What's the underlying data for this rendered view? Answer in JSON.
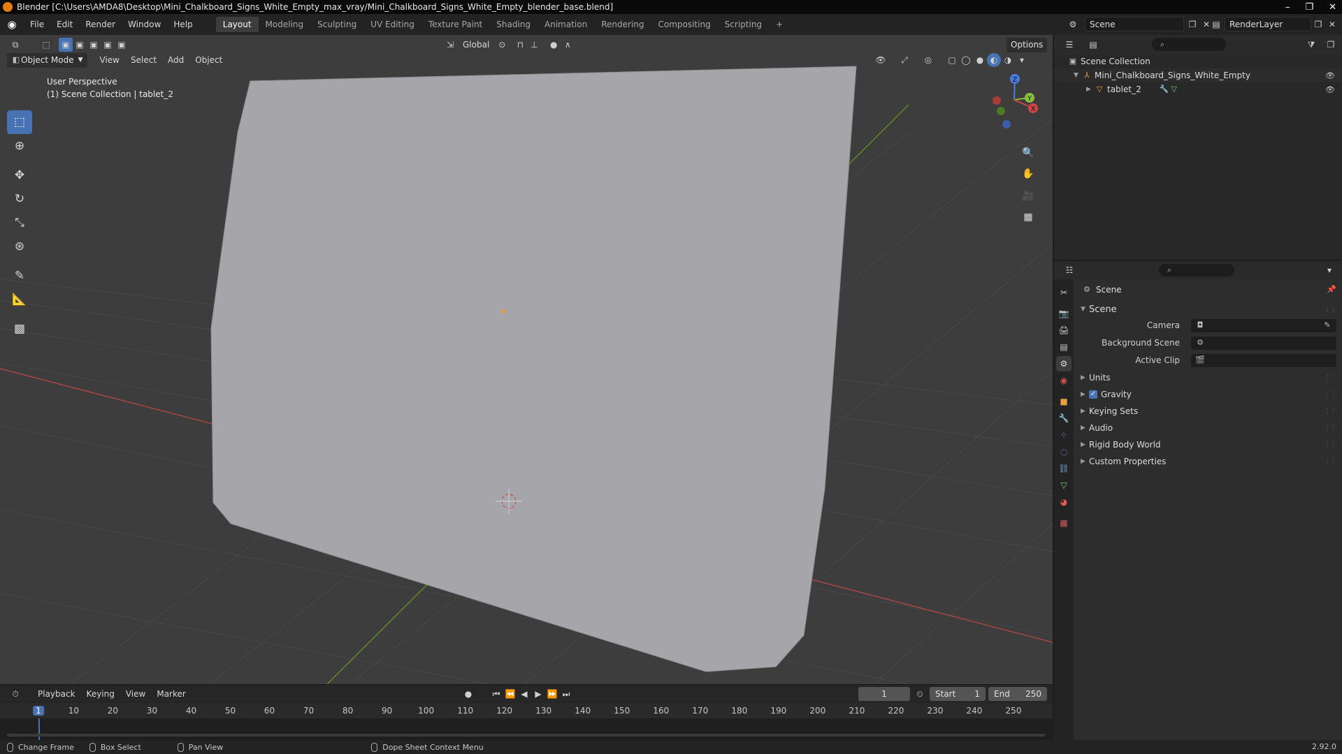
{
  "window": {
    "title": "Blender [C:\\Users\\AMDA8\\Desktop\\Mini_Chalkboard_Signs_White_Empty_max_vray/Mini_Chalkboard_Signs_White_Empty_blender_base.blend]",
    "minimize": "–",
    "maximize": "❐",
    "close": "✕"
  },
  "menu": {
    "items": [
      "File",
      "Edit",
      "Render",
      "Window",
      "Help"
    ],
    "workspaces": [
      "Layout",
      "Modeling",
      "Sculpting",
      "UV Editing",
      "Texture Paint",
      "Shading",
      "Animation",
      "Rendering",
      "Compositing",
      "Scripting"
    ],
    "active_workspace": "Layout",
    "add_workspace": "+",
    "scene": "Scene",
    "view_layer": "RenderLayer"
  },
  "viewport": {
    "mode": "Object Mode",
    "menus": [
      "View",
      "Select",
      "Add",
      "Object"
    ],
    "transform_orientation": "Global",
    "options": "Options",
    "perspective_label": "User Perspective",
    "collection_label": "(1) Scene Collection | tablet_2",
    "colors": {
      "background": "#3d3d3d",
      "board": "#a6a5aa",
      "axis_x": "#b44a4a",
      "axis_y": "#6b9a2a",
      "selected_active": "#4772b3"
    }
  },
  "gizmo": {
    "z": "Z",
    "y": "Y",
    "x": "X"
  },
  "timeline": {
    "menus": [
      "Playback",
      "Keying",
      "View",
      "Marker"
    ],
    "current_frame": "1",
    "start_label": "Start",
    "start": "1",
    "end_label": "End",
    "end": "250",
    "ticks": [
      "1",
      "10",
      "20",
      "30",
      "40",
      "50",
      "60",
      "70",
      "80",
      "90",
      "100",
      "110",
      "120",
      "130",
      "140",
      "150",
      "160",
      "170",
      "180",
      "190",
      "200",
      "210",
      "220",
      "230",
      "240",
      "250"
    ]
  },
  "status": {
    "items": [
      "Change Frame",
      "Box Select",
      "Pan View",
      "Dope Sheet Context Menu"
    ],
    "version": "2.92.0"
  },
  "outliner": {
    "root": "Scene Collection",
    "collection": "Mini_Chalkboard_Signs_White_Empty",
    "object": "tablet_2"
  },
  "properties": {
    "context_title": "Scene",
    "panel_scene": "Scene",
    "camera_label": "Camera",
    "background_scene_label": "Background Scene",
    "active_clip_label": "Active Clip",
    "panels": [
      "Units",
      "Gravity",
      "Keying Sets",
      "Audio",
      "Rigid Body World",
      "Custom Properties"
    ]
  }
}
